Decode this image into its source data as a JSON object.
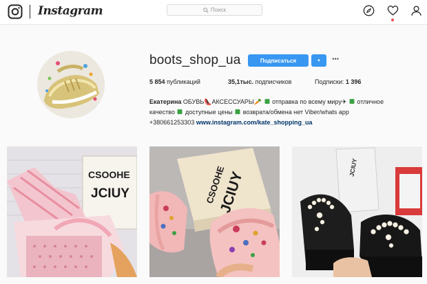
{
  "nav": {
    "logo_text": "Instagram",
    "search_placeholder": "Поиск",
    "icons": [
      "instagram-glyph-icon",
      "search-icon",
      "compass-icon",
      "heart-icon",
      "person-icon"
    ],
    "notification_dot": true
  },
  "profile": {
    "username": "boots_shop_ua",
    "follow_label": "Подписаться",
    "dropdown_glyph": "▾",
    "more_glyph": "···",
    "stats": {
      "posts_count": "5 854",
      "posts_label": " публикаций",
      "followers_count": "35,1тыс.",
      "followers_label": " подписчиков",
      "following_label": "Подписки: ",
      "following_count": "1 396"
    },
    "bio": {
      "name": "Екатерина",
      "line1_a": " ОБУВЬ👠АКСЕССУАРЫ🥕 ",
      "line1_b": "отправка по всему миру✈ ",
      "line1_c": "отличное",
      "line2_a": "качество ",
      "line2_b": "доступные цены ",
      "line2_c": "возврата/обмена нет Viber/whats app",
      "line3_phone": "+380661253303 ",
      "line3_link": "www.instagram.com/kate_shopping_ua"
    }
  },
  "grid": {
    "photos": [
      {
        "box_text_1": "CSOOHE",
        "box_text_2": "JCIUY"
      },
      {
        "box_text_1": "CSOOHE",
        "box_text_2": "JCIUY"
      },
      {
        "box_text_1": "JCIUY"
      }
    ]
  },
  "colors": {
    "accent": "#3897f0",
    "link": "#003569",
    "background": "#fafafa",
    "notification": "#ed4956"
  }
}
